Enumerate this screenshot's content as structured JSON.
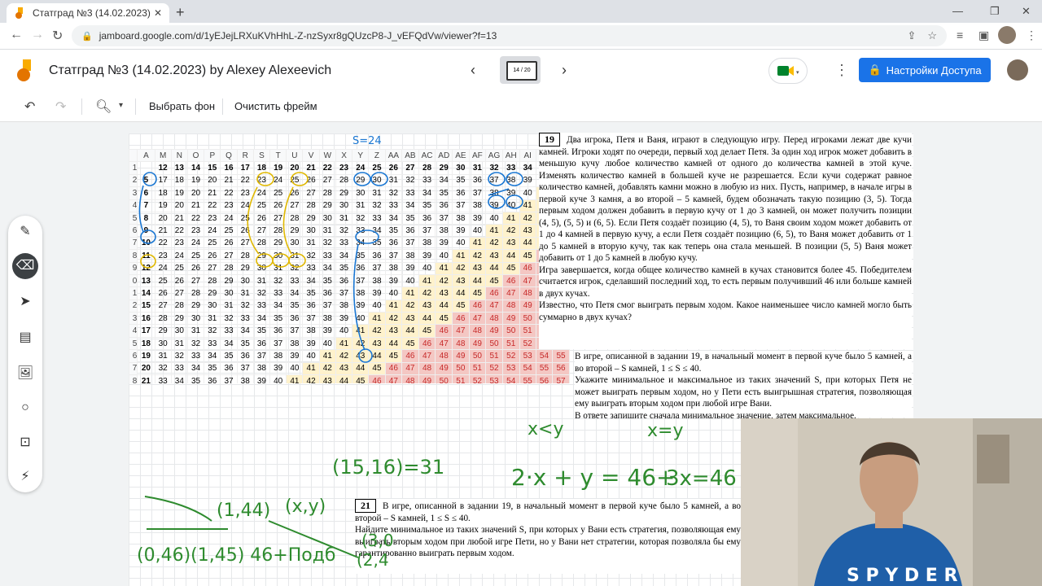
{
  "browser": {
    "tab_title": "Статград №3 (14.02.2023) by Ale",
    "url": "jamboard.google.com/d/1yEJejLRXuKVhHhL-Z-nzSyxr8gQUzcP8-J_vEFQdVw/viewer?f=13"
  },
  "jamboard": {
    "title": "Статград №3 (14.02.2023) by Alexey Alexeevich",
    "frame_indicator": "14 / 20",
    "share_label": "Настройки Доступа",
    "set_background": "Выбрать фон",
    "clear_frame": "Очистить фрейм"
  },
  "sheet": {
    "columns": [
      "A",
      "M",
      "N",
      "O",
      "P",
      "Q",
      "R",
      "S",
      "T",
      "U",
      "V",
      "W",
      "X",
      "Y",
      "Z",
      "AA",
      "AB",
      "AC",
      "AD",
      "AE",
      "AF",
      "AG",
      "AH",
      "AI",
      "AJ",
      "AK"
    ],
    "header_values": [
      "",
      "12",
      "13",
      "14",
      "15",
      "16",
      "17",
      "18",
      "19",
      "20",
      "21",
      "22",
      "23",
      "24",
      "25",
      "26",
      "27",
      "28",
      "29",
      "30",
      "31",
      "32",
      "33",
      "34",
      "35",
      "36"
    ],
    "row_labels": [
      "2",
      "3",
      "4",
      "5",
      "6",
      "7",
      "8",
      "9",
      "0",
      "1",
      "2",
      "3",
      "4",
      "5",
      "6",
      "7",
      "8",
      "9"
    ],
    "row_first": [
      "5",
      "6",
      "7",
      "8",
      "9",
      "10",
      "11",
      "12",
      "13",
      "14",
      "15",
      "16",
      "17",
      "18",
      "19",
      "20",
      "21",
      "22"
    ],
    "highlight_cell": "45"
  },
  "task19": {
    "number": "19",
    "text": "Два игрока, Петя и Ваня, играют в следующую игру. Перед игроками лежат две кучи камней. Игроки ходят по очереди, первый ход делает Петя. За один ход игрок может добавить в меньшую кучу любое количество камней от одного до количества камней в этой куче. Изменять количество камней в большей куче не разрешается. Если кучи содержат равное количество камней, добавлять камни можно в любую из них. Пусть, например, в начале игры в первой куче 3 камня, а во второй – 5 камней, будем обозначать такую позицию (3, 5). Тогда первым ходом должен добавить в первую кучу от 1 до 3 камней, он может получить позиции (4, 5), (5, 5) и (6, 5). Если Петя создаёт позицию (4, 5), то Ваня своим ходом может добавить от 1 до 4 камней в первую кучу, а если Петя создаёт позицию (6, 5), то Ваня может добавить от 1 до 5 камней в вторую кучу, так как теперь она стала меньшей. В позиции (5, 5) Ваня может добавить от 1 до 5 камней в любую кучу.",
    "end": "Игра завершается, когда общее количество камней в кучах становится более 45. Победителем считается игрок, сделавший последний ход, то есть первым получивший 46 или больше камней в двух кучах.",
    "question": "Известно, что Петя смог выиграть первым ходом. Какое наименьшее число камней могло быть суммарно в двух кучах?"
  },
  "task20": {
    "text": "В игре, описанной в задании 19, в начальный момент в первой куче было 5 камней, а во второй – S камней, 1 ≤ S ≤ 40.",
    "question": "Укажите минимальное и максимальное из таких значений S, при которых Петя не может выиграть первым ходом, но у Пети есть выигрышная стратегия, позволяющая ему выиграть вторым ходом при любой игре Вани.",
    "answer_note": "В ответе запишите сначала минимальное значение, затем максимальное."
  },
  "task21": {
    "number": "21",
    "text": "В игре, описанной в задании 19, в начальный момент в первой куче было 5 камней, а во второй – S камней, 1 ≤ S ≤ 40.",
    "question": "Найдите минимальное из таких значений S, при которых у Вани есть стратегия, позволяющая ему выиграть вторым ходом при любой игре Пети, но у Вани нет стратегии, которая позволяла бы ему гарантированно выиграть первым ходом."
  },
  "handwriting": {
    "s24": "S=24",
    "xy1": "x<y",
    "xy2": "x=y",
    "eq1": "2·x + y = 46+",
    "eq2": "3x=46",
    "pair1": "(15,16)=31",
    "pair2": "(1,44)",
    "pair3": "(x,y)",
    "pair4": "(0,46)(1,45) 46+Подб",
    "pair5": "(3,0",
    "pair6": "(2,4"
  },
  "colors": {
    "accent": "#1a73e8",
    "ink_green": "#2e8b2e",
    "ink_blue": "#1976d2",
    "ink_yellow": "#e0b800"
  }
}
